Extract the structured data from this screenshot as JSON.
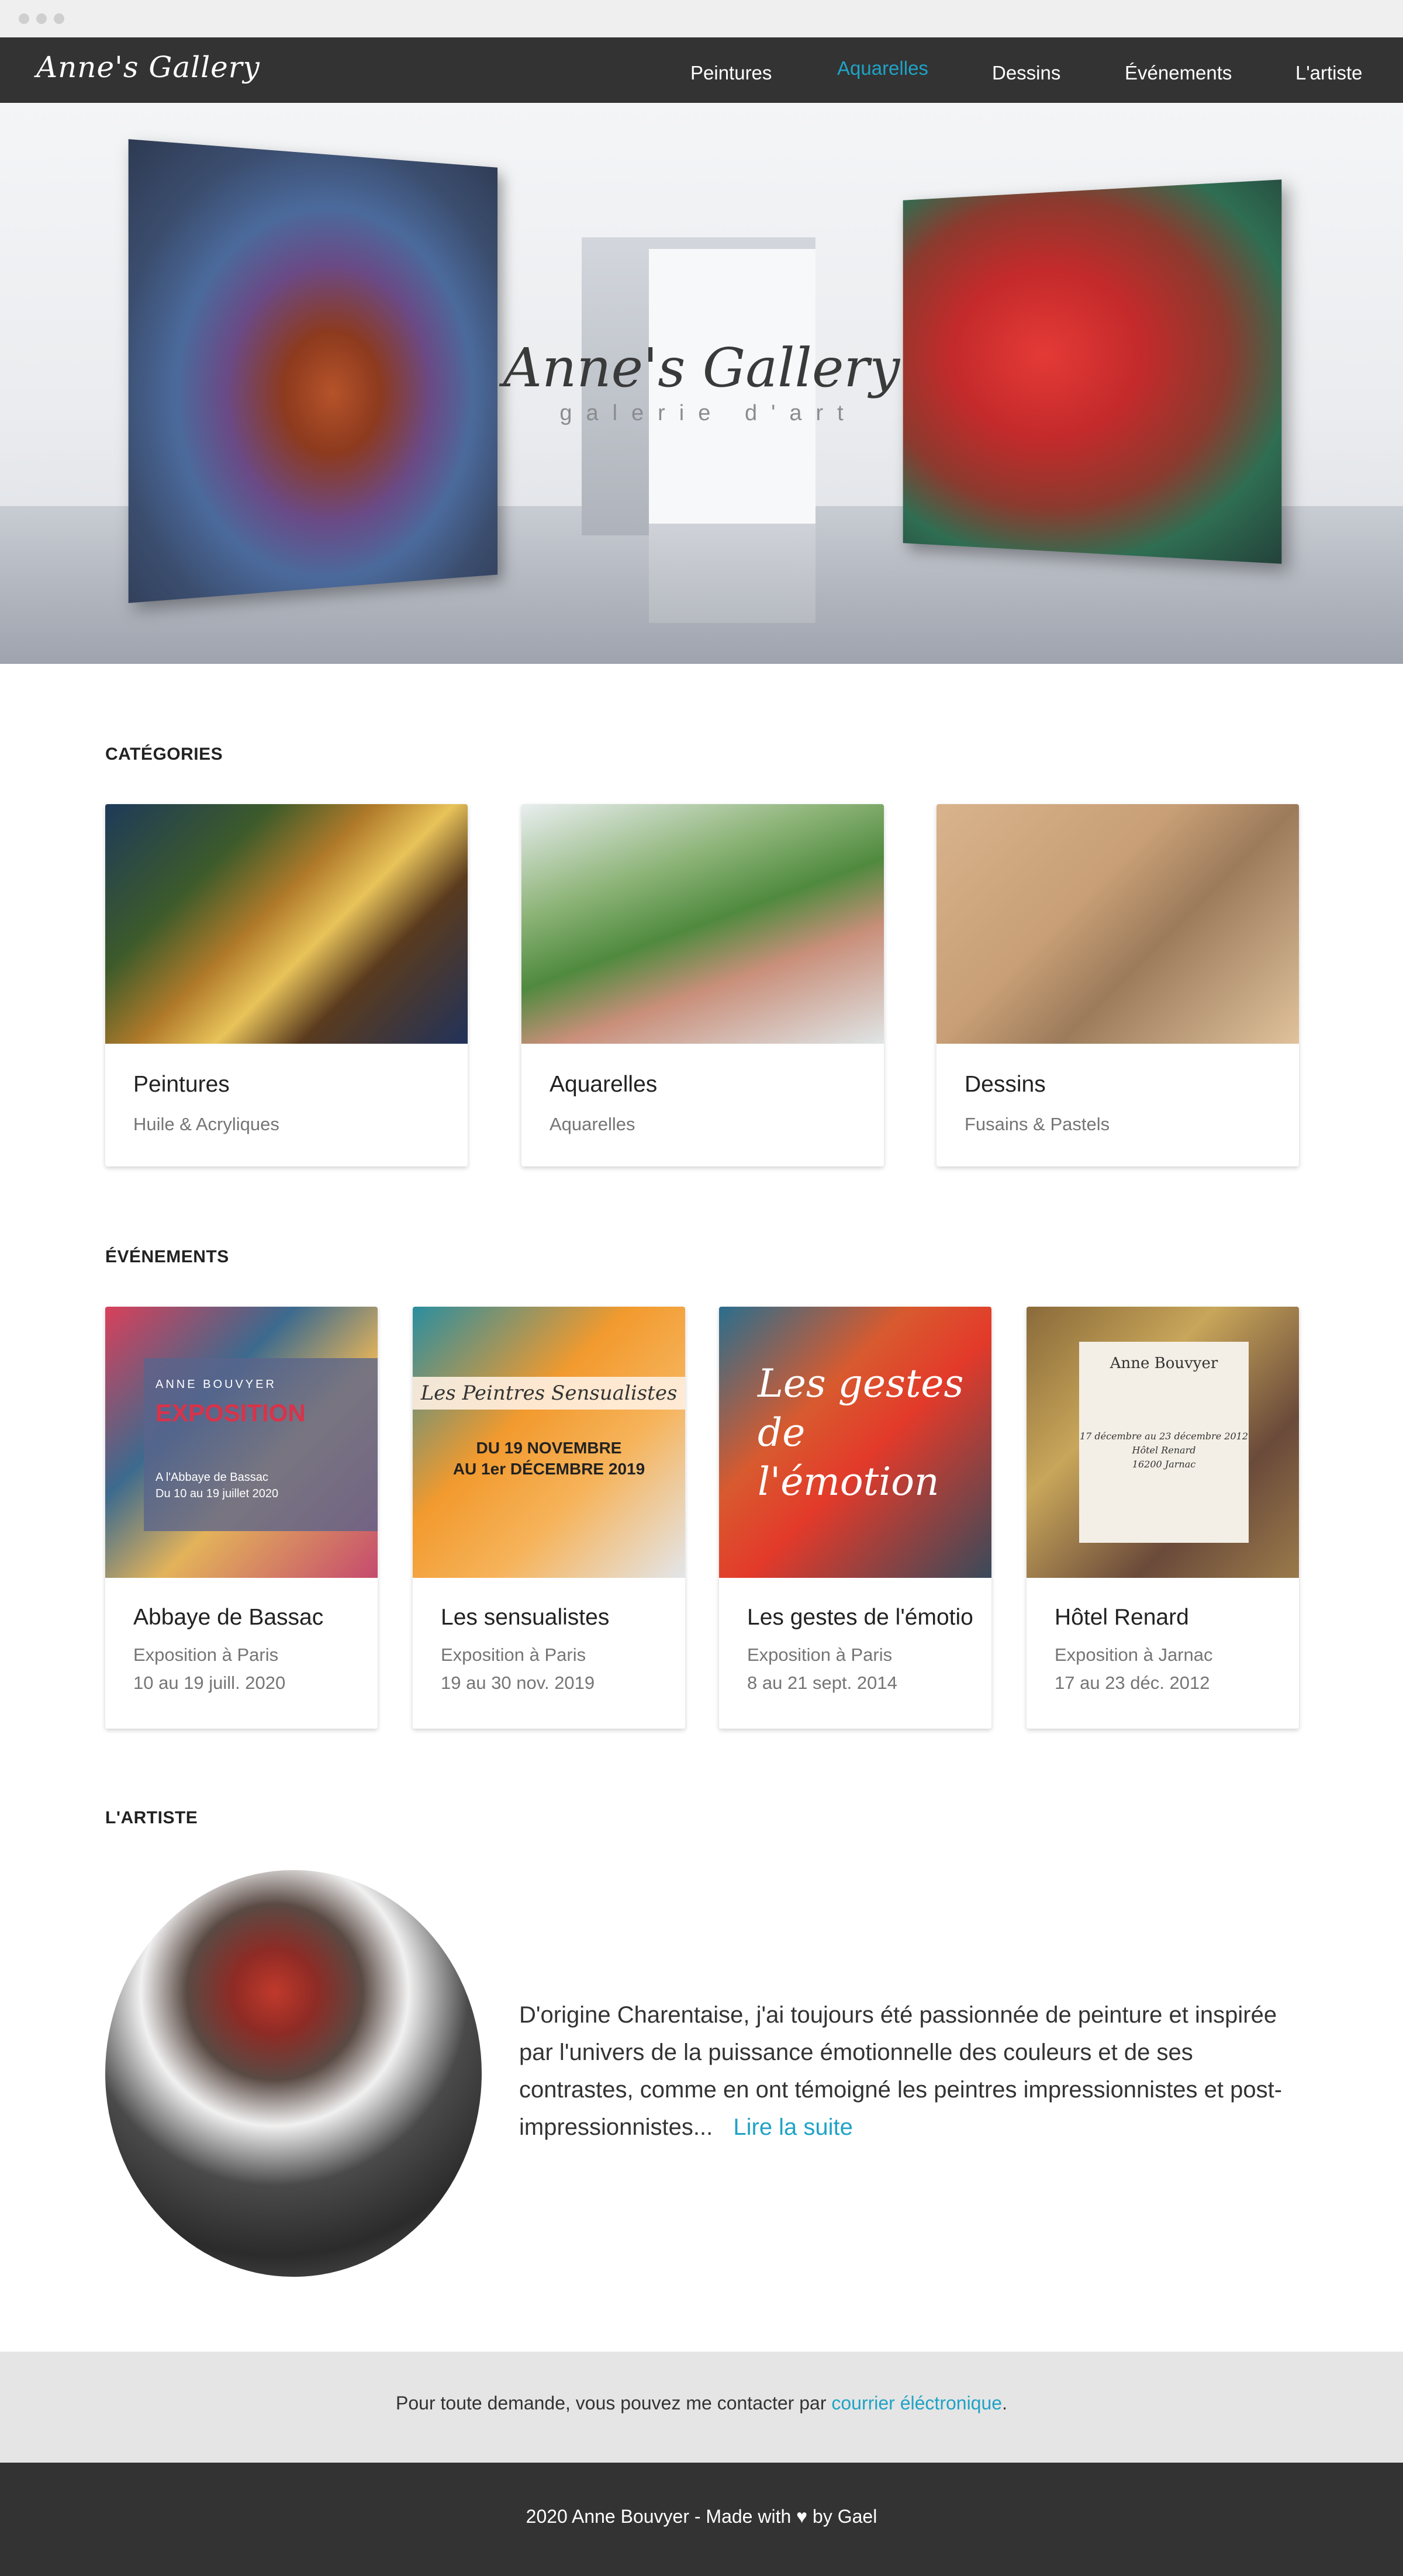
{
  "nav": {
    "logo": "Anne's Gallery",
    "items": [
      {
        "label": "Peintures",
        "active": false
      },
      {
        "label": "Aquarelles",
        "active": true
      },
      {
        "label": "Dessins",
        "active": false
      },
      {
        "label": "Événements",
        "active": false
      },
      {
        "label": "L'artiste",
        "active": false
      }
    ],
    "colors": {
      "background": "#333333",
      "active": "#1fa3c6",
      "text": "#ffffff"
    }
  },
  "hero": {
    "title": "Anne's Gallery",
    "subtitle": "galerie d'art"
  },
  "categories": {
    "heading": "CATÉGORIES",
    "cards": [
      {
        "title": "Peintures",
        "subtitle": "Huile & Acryliques"
      },
      {
        "title": "Aquarelles",
        "subtitle": "Aquarelles"
      },
      {
        "title": "Dessins",
        "subtitle": "Fusains & Pastels"
      }
    ]
  },
  "events": {
    "heading": "ÉVÉNEMENTS",
    "cards": [
      {
        "title": "Abbaye de Bassac",
        "place": "Exposition à Paris",
        "dates": "10 au 19 juill. 2020",
        "poster": {
          "artist": "ANNE BOUVYER",
          "headline": "EXPOSITION",
          "details": "A l'Abbaye de Bassac\nDu 10 au 19 juillet 2020"
        }
      },
      {
        "title": "Les sensualistes",
        "place": "Exposition à Paris",
        "dates": "19 au 30 nov. 2019",
        "poster": {
          "headline": "Les Peintres Sensualistes",
          "details": "DU 19 NOVEMBRE\nAU 1er DÉCEMBRE 2019"
        }
      },
      {
        "title": "Les gestes de l'émotio",
        "place": "Exposition à Paris",
        "dates": "8 au 21 sept. 2014",
        "poster": {
          "headline": "Les gestes de l'émotion"
        }
      },
      {
        "title": "Hôtel Renard",
        "place": "Exposition à Jarnac",
        "dates": "17 au 23 déc. 2012",
        "poster": {
          "artist": "Anne Bouvyer",
          "details": "17 décembre au 23 décembre 2012\nHôtel Renard\n16200 Jarnac"
        }
      }
    ]
  },
  "artist": {
    "heading": "L'ARTISTE",
    "bio": "D'origine Charentaise, j'ai toujours été passionnée de peinture et inspirée par l'univers de la puissance émotionnelle des couleurs et de ses contrastes, comme en ont témoigné les peintres impressionnistes et post- impressionnistes...",
    "read_more": "Lire la suite"
  },
  "footer": {
    "contact_text": "Pour toute demande, vous pouvez me contacter par ",
    "contact_link": "courrier éléctronique",
    "contact_end": ".",
    "copyright": "2020 Anne Bouvyer - Made with ♥ by Gael"
  }
}
